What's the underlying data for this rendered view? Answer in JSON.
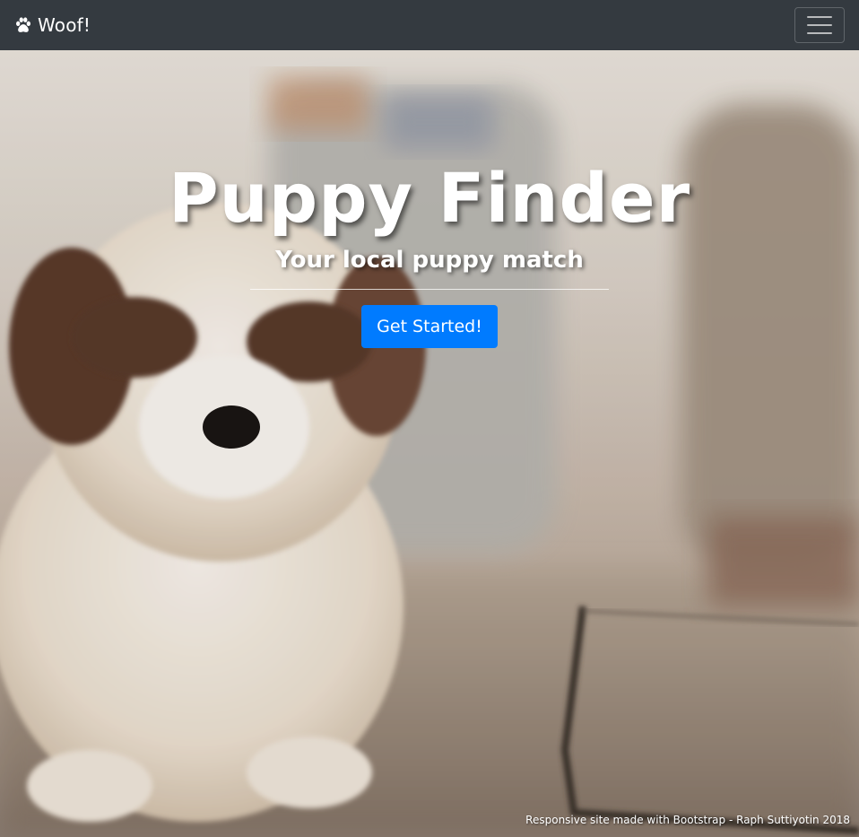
{
  "navbar": {
    "brand_label": "Woof!",
    "brand_icon": "paw-icon",
    "menu_icon": "hamburger-menu-icon",
    "background_color": "#343a40"
  },
  "hero": {
    "title": "Puppy Finder",
    "subtitle": "Your local puppy match",
    "cta_label": "Get Started!",
    "cta_color": "#007bff"
  },
  "footer": {
    "credit": "Responsive site made with Bootstrap - Raph Suttiyotin 2018"
  }
}
